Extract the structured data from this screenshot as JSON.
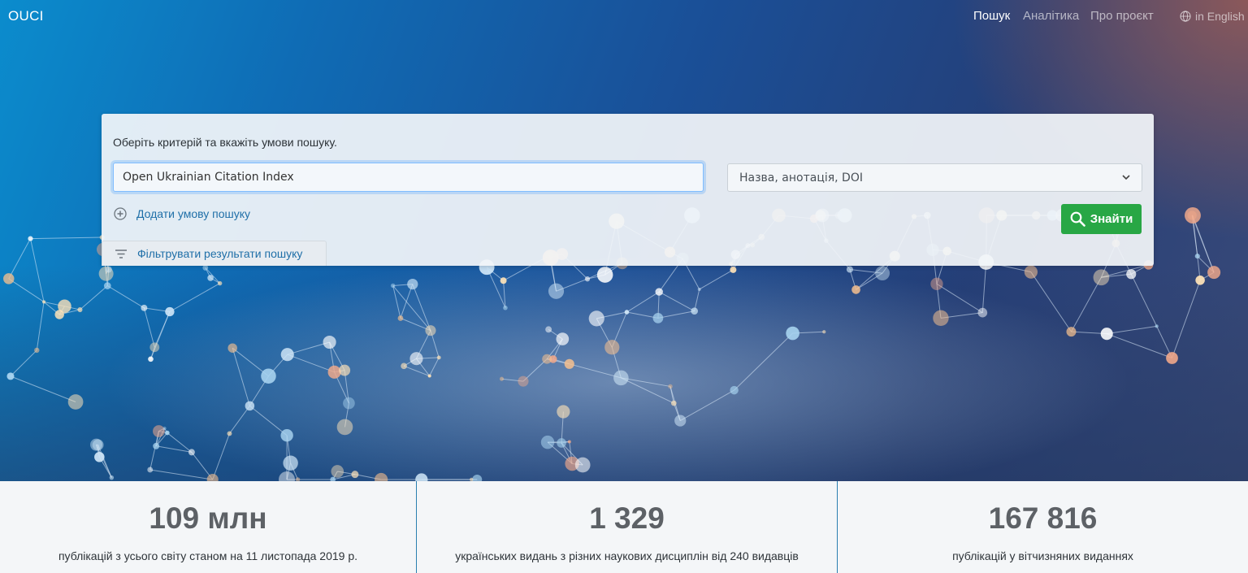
{
  "header": {
    "brand": "OUCI",
    "nav": [
      {
        "label": "Пошук",
        "active": true
      },
      {
        "label": "Аналітика",
        "active": false
      },
      {
        "label": "Про проєкт",
        "active": false
      }
    ],
    "language_link": "in English"
  },
  "search": {
    "instruction": "Оберіть критерій та вкажіть умови пошуку.",
    "query_value": "Open Ukrainian Citation Index",
    "criterion_selected": "Назва, анотація, DOI",
    "add_condition": "Додати умову пошуку",
    "find_button": "Знайти",
    "filter_results": "Фільтрувати результати пошуку"
  },
  "stats": [
    {
      "value": "109 млн",
      "description": "публікацій з усього світу станом на 11 листопада 2019 р."
    },
    {
      "value": "1 329",
      "description": "українських видань з різних наукових дисциплін від 240 видавців"
    },
    {
      "value": "167 816",
      "description": "публікацій у вітчизняних виданнях"
    }
  ],
  "colors": {
    "accent_button": "#28a745",
    "link": "#1f6fa8",
    "divider": "#2a7fb0"
  }
}
